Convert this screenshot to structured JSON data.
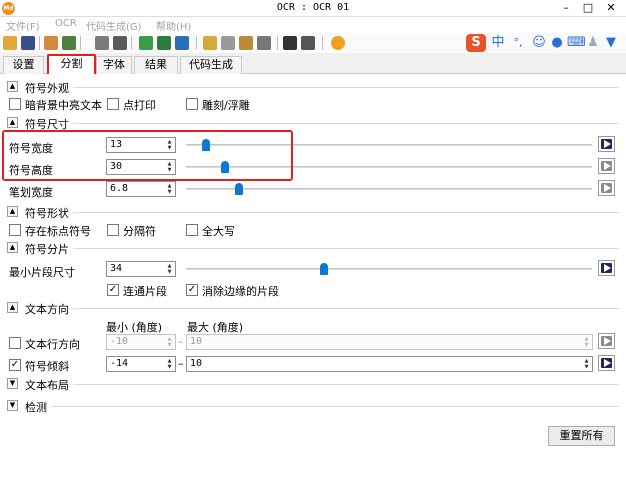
{
  "window": {
    "title": "OCR : OCR 01",
    "app_icon_text": "Md"
  },
  "menu": [
    {
      "label": "文件(F)"
    },
    {
      "label": "OCR"
    },
    {
      "label": "代码生成(G)"
    },
    {
      "label": "帮助(H)"
    }
  ],
  "tabs": [
    {
      "label": "设置"
    },
    {
      "label": "分割"
    },
    {
      "label": "字体"
    },
    {
      "label": "结果"
    },
    {
      "label": "代码生成"
    }
  ],
  "sections": {
    "appearance": "符号外观",
    "size": "符号尺寸",
    "shape": "符号形状",
    "fragment": "符号分片",
    "direction": "文本方向",
    "layout": "文本布局",
    "detect": "检测"
  },
  "appearance": {
    "dark_bg": "暗背景中亮文本",
    "dot_print": "点打印",
    "engraved": "雕刻/浮雕"
  },
  "size": {
    "width": {
      "label": "符号宽度",
      "value": "13",
      "fraction": 0.05
    },
    "height": {
      "label": "符号高度",
      "value": "30",
      "fraction": 0.097
    },
    "stroke": {
      "label": "笔划宽度",
      "value": "6.8",
      "fraction": 0.13
    }
  },
  "shape": {
    "punct": "存在标点符号",
    "separator": "分隔符",
    "uppercase": "全大写"
  },
  "fragment": {
    "min_size": {
      "label": "最小片段尺寸",
      "value": "34",
      "fraction": 0.34
    },
    "connected": "连通片段",
    "remove_edge": "消除边缘的片段"
  },
  "direction": {
    "min_header": "最小 (角度)",
    "max_header": "最大 (角度)",
    "line_dir": {
      "label": "文本行方向",
      "min": "-10",
      "max": "10"
    },
    "slant": {
      "label": "符号倾斜",
      "min": "-14",
      "max": "10"
    }
  },
  "buttons": {
    "reset": "重置所有"
  },
  "ime": {
    "lang": "中",
    "punct": "°,"
  },
  "colors": {
    "accent": "#0a78d7",
    "highlight": "#e02020"
  }
}
